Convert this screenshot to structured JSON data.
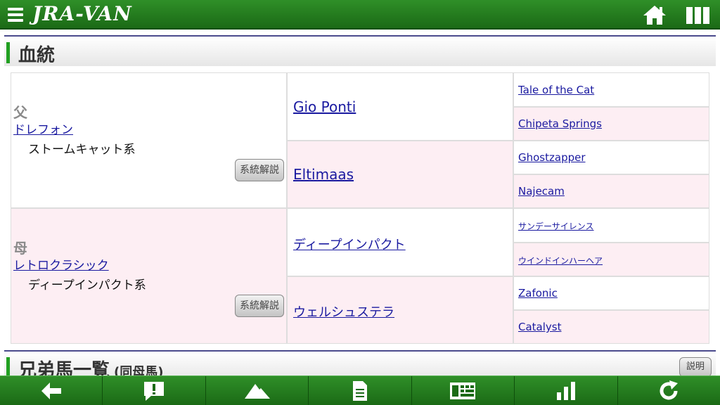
{
  "header": {
    "logo": "JRA-VAN",
    "icons": [
      "menu-icon",
      "home-icon",
      "grid-icon"
    ]
  },
  "pedigree_section": {
    "title": "血統",
    "sire": {
      "label": "父",
      "name": "ドレフォン",
      "lineage": "ストームキャット系",
      "explain_label": "系統解説"
    },
    "dam": {
      "label": "母",
      "name": "レトロクラシック",
      "lineage": "ディープインパクト系",
      "explain_label": "系統解説"
    },
    "gen2": [
      "Gio Ponti",
      "Eltimaas",
      "ディープインパクト",
      "ウェルシュステラ"
    ],
    "gen3": [
      "Tale of the Cat",
      "Chipeta Springs",
      "Ghostzapper",
      "Najecam",
      "サンデーサイレンス",
      "ウインドインハーヘア",
      "Zafonic",
      "Catalyst"
    ]
  },
  "siblings_section": {
    "title": "兄弟馬一覧",
    "subtitle": "(同母馬)",
    "explain_label": "説明"
  },
  "toolbar": {
    "buttons": [
      "back-arrow-icon",
      "alert-icon",
      "mountain-icon",
      "document-icon",
      "table-icon",
      "bar-chart-icon",
      "refresh-icon"
    ]
  },
  "colors": {
    "header_green": "#1b6a16",
    "accent_green": "#22a022",
    "row_pink": "#fdeef3",
    "link_blue": "#1a1aa0"
  }
}
